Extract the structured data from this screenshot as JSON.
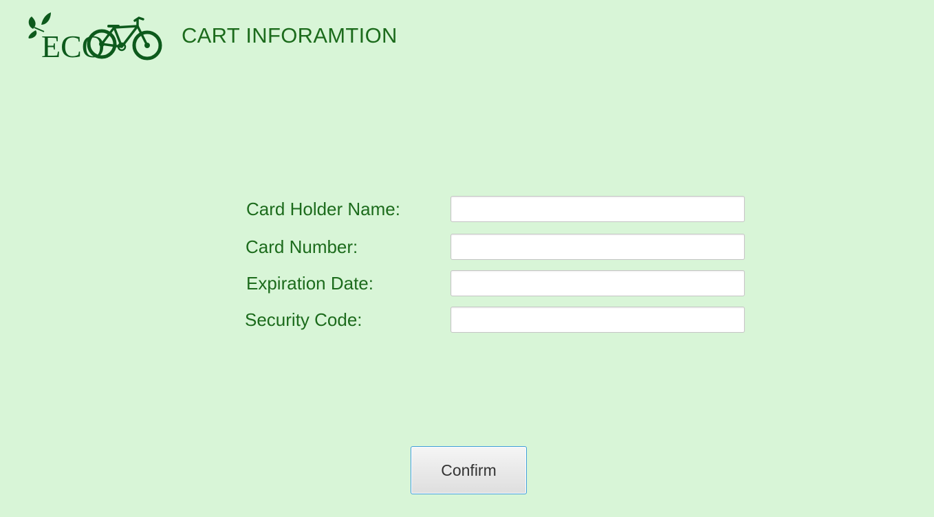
{
  "header": {
    "logo_text": "ECO",
    "title": "CART INFORAMTION"
  },
  "form": {
    "fields": [
      {
        "label": "Card Holder Name:",
        "value": "",
        "placeholder": ""
      },
      {
        "label": "Card Number:",
        "value": "",
        "placeholder": ""
      },
      {
        "label": "Expiration Date:",
        "value": "",
        "placeholder": ""
      },
      {
        "label": "Security Code:",
        "value": "",
        "placeholder": ""
      }
    ]
  },
  "actions": {
    "confirm_label": "Confirm"
  },
  "colors": {
    "background": "#d8f5d7",
    "brand_green": "#0d5a1c",
    "text_green": "#1c6b1c",
    "button_border": "#3e9bd8"
  },
  "icons": {
    "logo": "eco-bicycle-leaf-logo"
  }
}
